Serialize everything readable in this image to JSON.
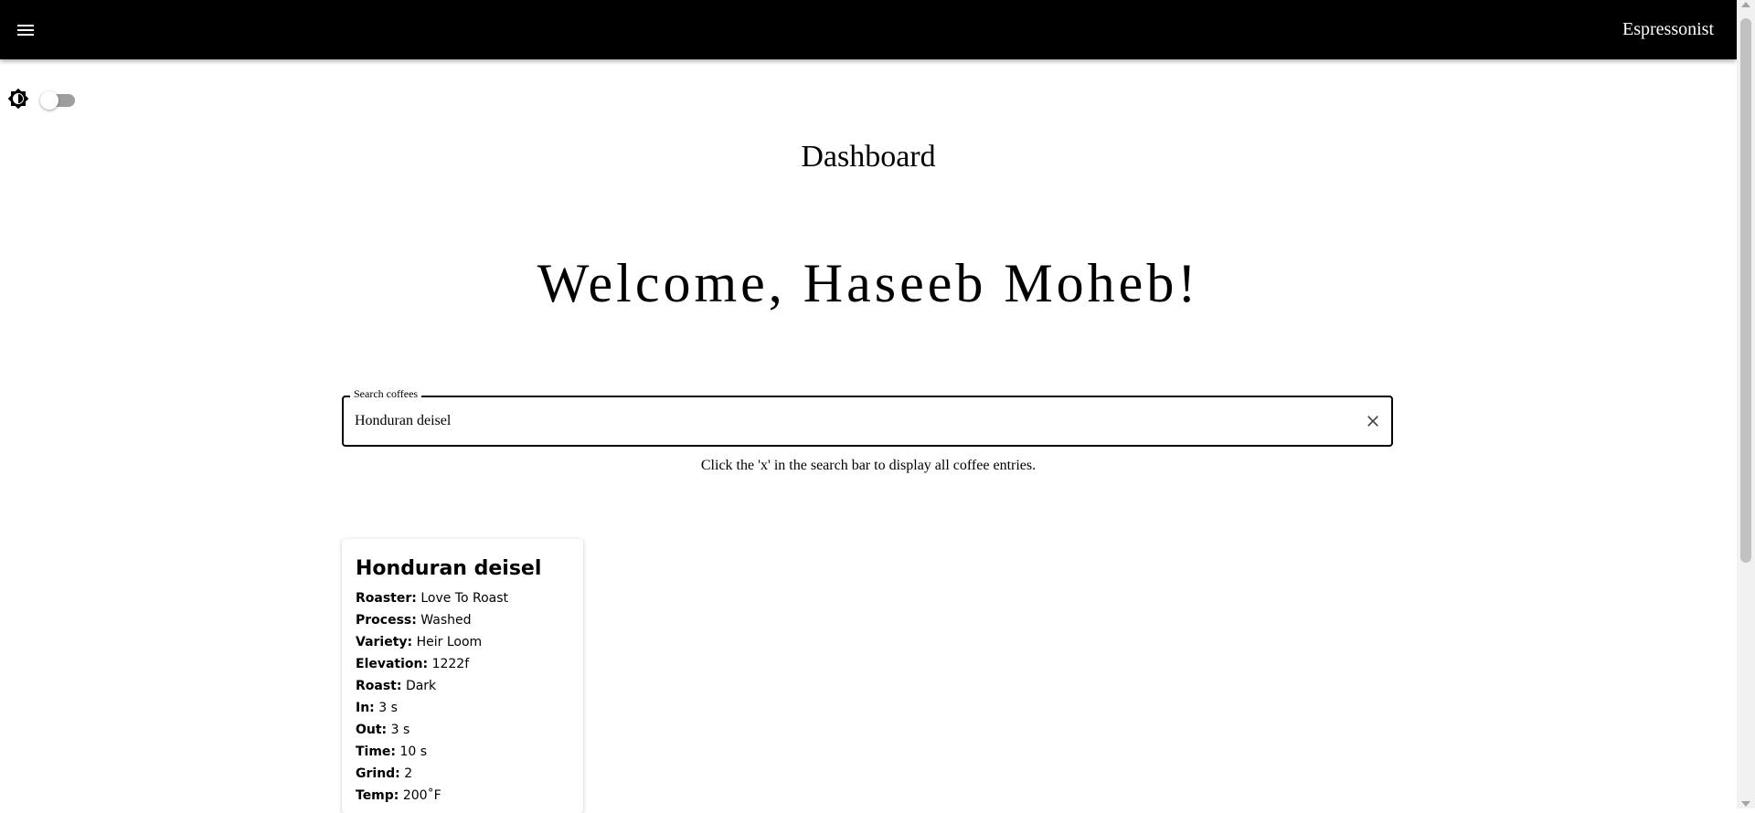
{
  "header": {
    "brand": "Espressonist",
    "menu_icon": "menu-icon"
  },
  "theme": {
    "icon": "brightness-icon",
    "dark_mode": false
  },
  "page_title": "Dashboard",
  "welcome": "Welcome, Haseeb Moheb!",
  "search": {
    "label": "Search coffees",
    "value": "Honduran deisel"
  },
  "hint": "Click the 'x' in the search bar to display all coffee entries.",
  "card": {
    "title": "Honduran deisel",
    "fields": [
      {
        "label": "Roaster:",
        "value": "Love To Roast"
      },
      {
        "label": "Process:",
        "value": "Washed"
      },
      {
        "label": "Variety:",
        "value": "Heir Loom"
      },
      {
        "label": "Elevation:",
        "value": "1222f"
      },
      {
        "label": "Roast:",
        "value": "Dark"
      },
      {
        "label": "In:",
        "value": "3 s"
      },
      {
        "label": "Out:",
        "value": "3 s"
      },
      {
        "label": "Time:",
        "value": "10 s"
      },
      {
        "label": "Grind:",
        "value": "2"
      },
      {
        "label": "Temp:",
        "value": "200˚F"
      }
    ]
  }
}
